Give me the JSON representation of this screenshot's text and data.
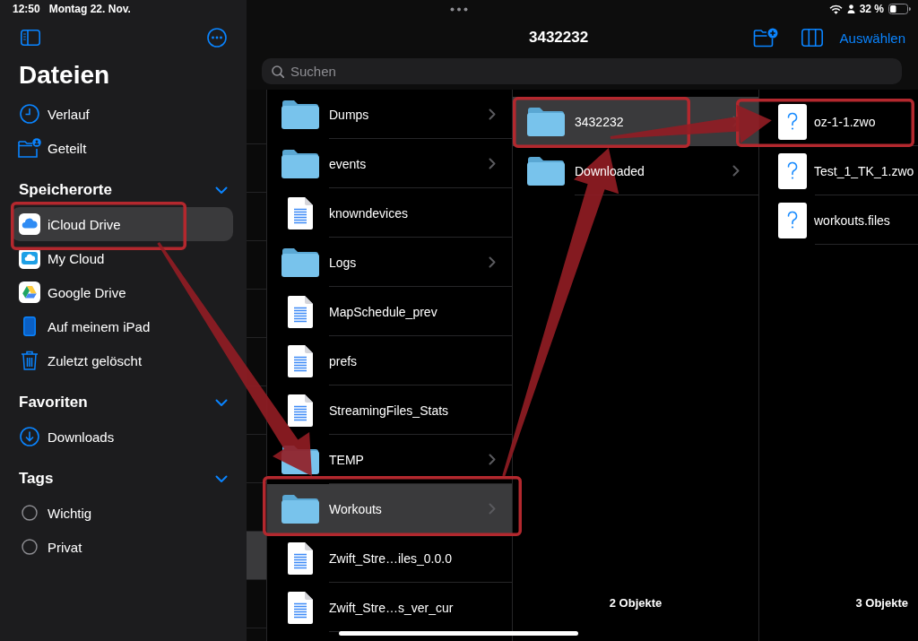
{
  "status_bar": {
    "time": "12:50",
    "date": "Montag 22. Nov.",
    "battery": "32 %"
  },
  "sidebar": {
    "title": "Dateien",
    "sections": [
      {
        "items": [
          {
            "label": "Verlauf",
            "kind": "recents",
            "selected": false,
            "marked": false
          },
          {
            "label": "Geteilt",
            "kind": "shared",
            "selected": false,
            "marked": false
          }
        ]
      },
      {
        "title": "Speicherorte",
        "expanded": true,
        "items": [
          {
            "label": "iCloud Drive",
            "kind": "icloud",
            "selected": true,
            "marked": true
          },
          {
            "label": "My Cloud",
            "kind": "mycloud",
            "selected": false,
            "marked": false
          },
          {
            "label": "Google Drive",
            "kind": "gdrive",
            "selected": false,
            "marked": false
          },
          {
            "label": "Auf meinem iPad",
            "kind": "device",
            "selected": false,
            "marked": false
          },
          {
            "label": "Zuletzt gelöscht",
            "kind": "trash",
            "selected": false,
            "marked": false
          }
        ]
      },
      {
        "title": "Favoriten",
        "expanded": true,
        "items": [
          {
            "label": "Downloads",
            "kind": "downloads",
            "selected": false,
            "marked": false
          }
        ]
      },
      {
        "title": "Tags",
        "expanded": true,
        "items": [
          {
            "label": "Wichtig",
            "kind": "tag",
            "selected": false,
            "marked": false
          },
          {
            "label": "Privat",
            "kind": "tag",
            "selected": false,
            "marked": false
          }
        ]
      }
    ]
  },
  "toolbar": {
    "title": "3432232",
    "select_label": "Auswählen"
  },
  "search": {
    "placeholder": "Suchen"
  },
  "clipped_column": {
    "rows": [
      {
        "selected": false
      },
      {
        "selected": false
      },
      {
        "selected": false
      },
      {
        "selected": false
      },
      {
        "selected": false
      },
      {
        "selected": false
      },
      {
        "selected": false
      },
      {
        "selected": false
      },
      {
        "selected": false
      },
      {
        "selected": true
      },
      {
        "selected": false
      }
    ]
  },
  "columns": [
    {
      "rows": [
        {
          "name": "Dumps",
          "kind": "folder",
          "selected": false,
          "marked": false
        },
        {
          "name": "events",
          "kind": "folder",
          "selected": false,
          "marked": false
        },
        {
          "name": "knowndevices",
          "kind": "document",
          "selected": false,
          "marked": false
        },
        {
          "name": "Logs",
          "kind": "folder",
          "selected": false,
          "marked": false
        },
        {
          "name": "MapSchedule_prev",
          "kind": "document",
          "selected": false,
          "marked": false
        },
        {
          "name": "prefs",
          "kind": "document",
          "selected": false,
          "marked": false
        },
        {
          "name": "StreamingFiles_Stats",
          "kind": "document",
          "selected": false,
          "marked": false
        },
        {
          "name": "TEMP",
          "kind": "folder",
          "selected": false,
          "marked": false
        },
        {
          "name": "Workouts",
          "kind": "folder",
          "selected": true,
          "marked": true
        },
        {
          "name": "Zwift_Stre…iles_0.0.0",
          "kind": "document",
          "selected": false,
          "marked": false
        },
        {
          "name": "Zwift_Stre…s_ver_cur",
          "kind": "document",
          "selected": false,
          "marked": false
        }
      ]
    },
    {
      "rows": [
        {
          "name": "3432232",
          "kind": "folder",
          "selected": true,
          "marked": true
        },
        {
          "name": "Downloaded",
          "kind": "folder",
          "selected": false,
          "marked": false
        }
      ],
      "footer": "2 Objekte"
    },
    {
      "rows": [
        {
          "name": "oz-1-1.zwo",
          "kind": "unknown",
          "selected": false,
          "marked": true
        },
        {
          "name": "Test_1_TK_1.zwo",
          "kind": "unknown",
          "selected": false,
          "marked": false
        },
        {
          "name": "workouts.files",
          "kind": "unknown",
          "selected": false,
          "marked": false
        }
      ],
      "footer": "3 Objekte"
    }
  ]
}
